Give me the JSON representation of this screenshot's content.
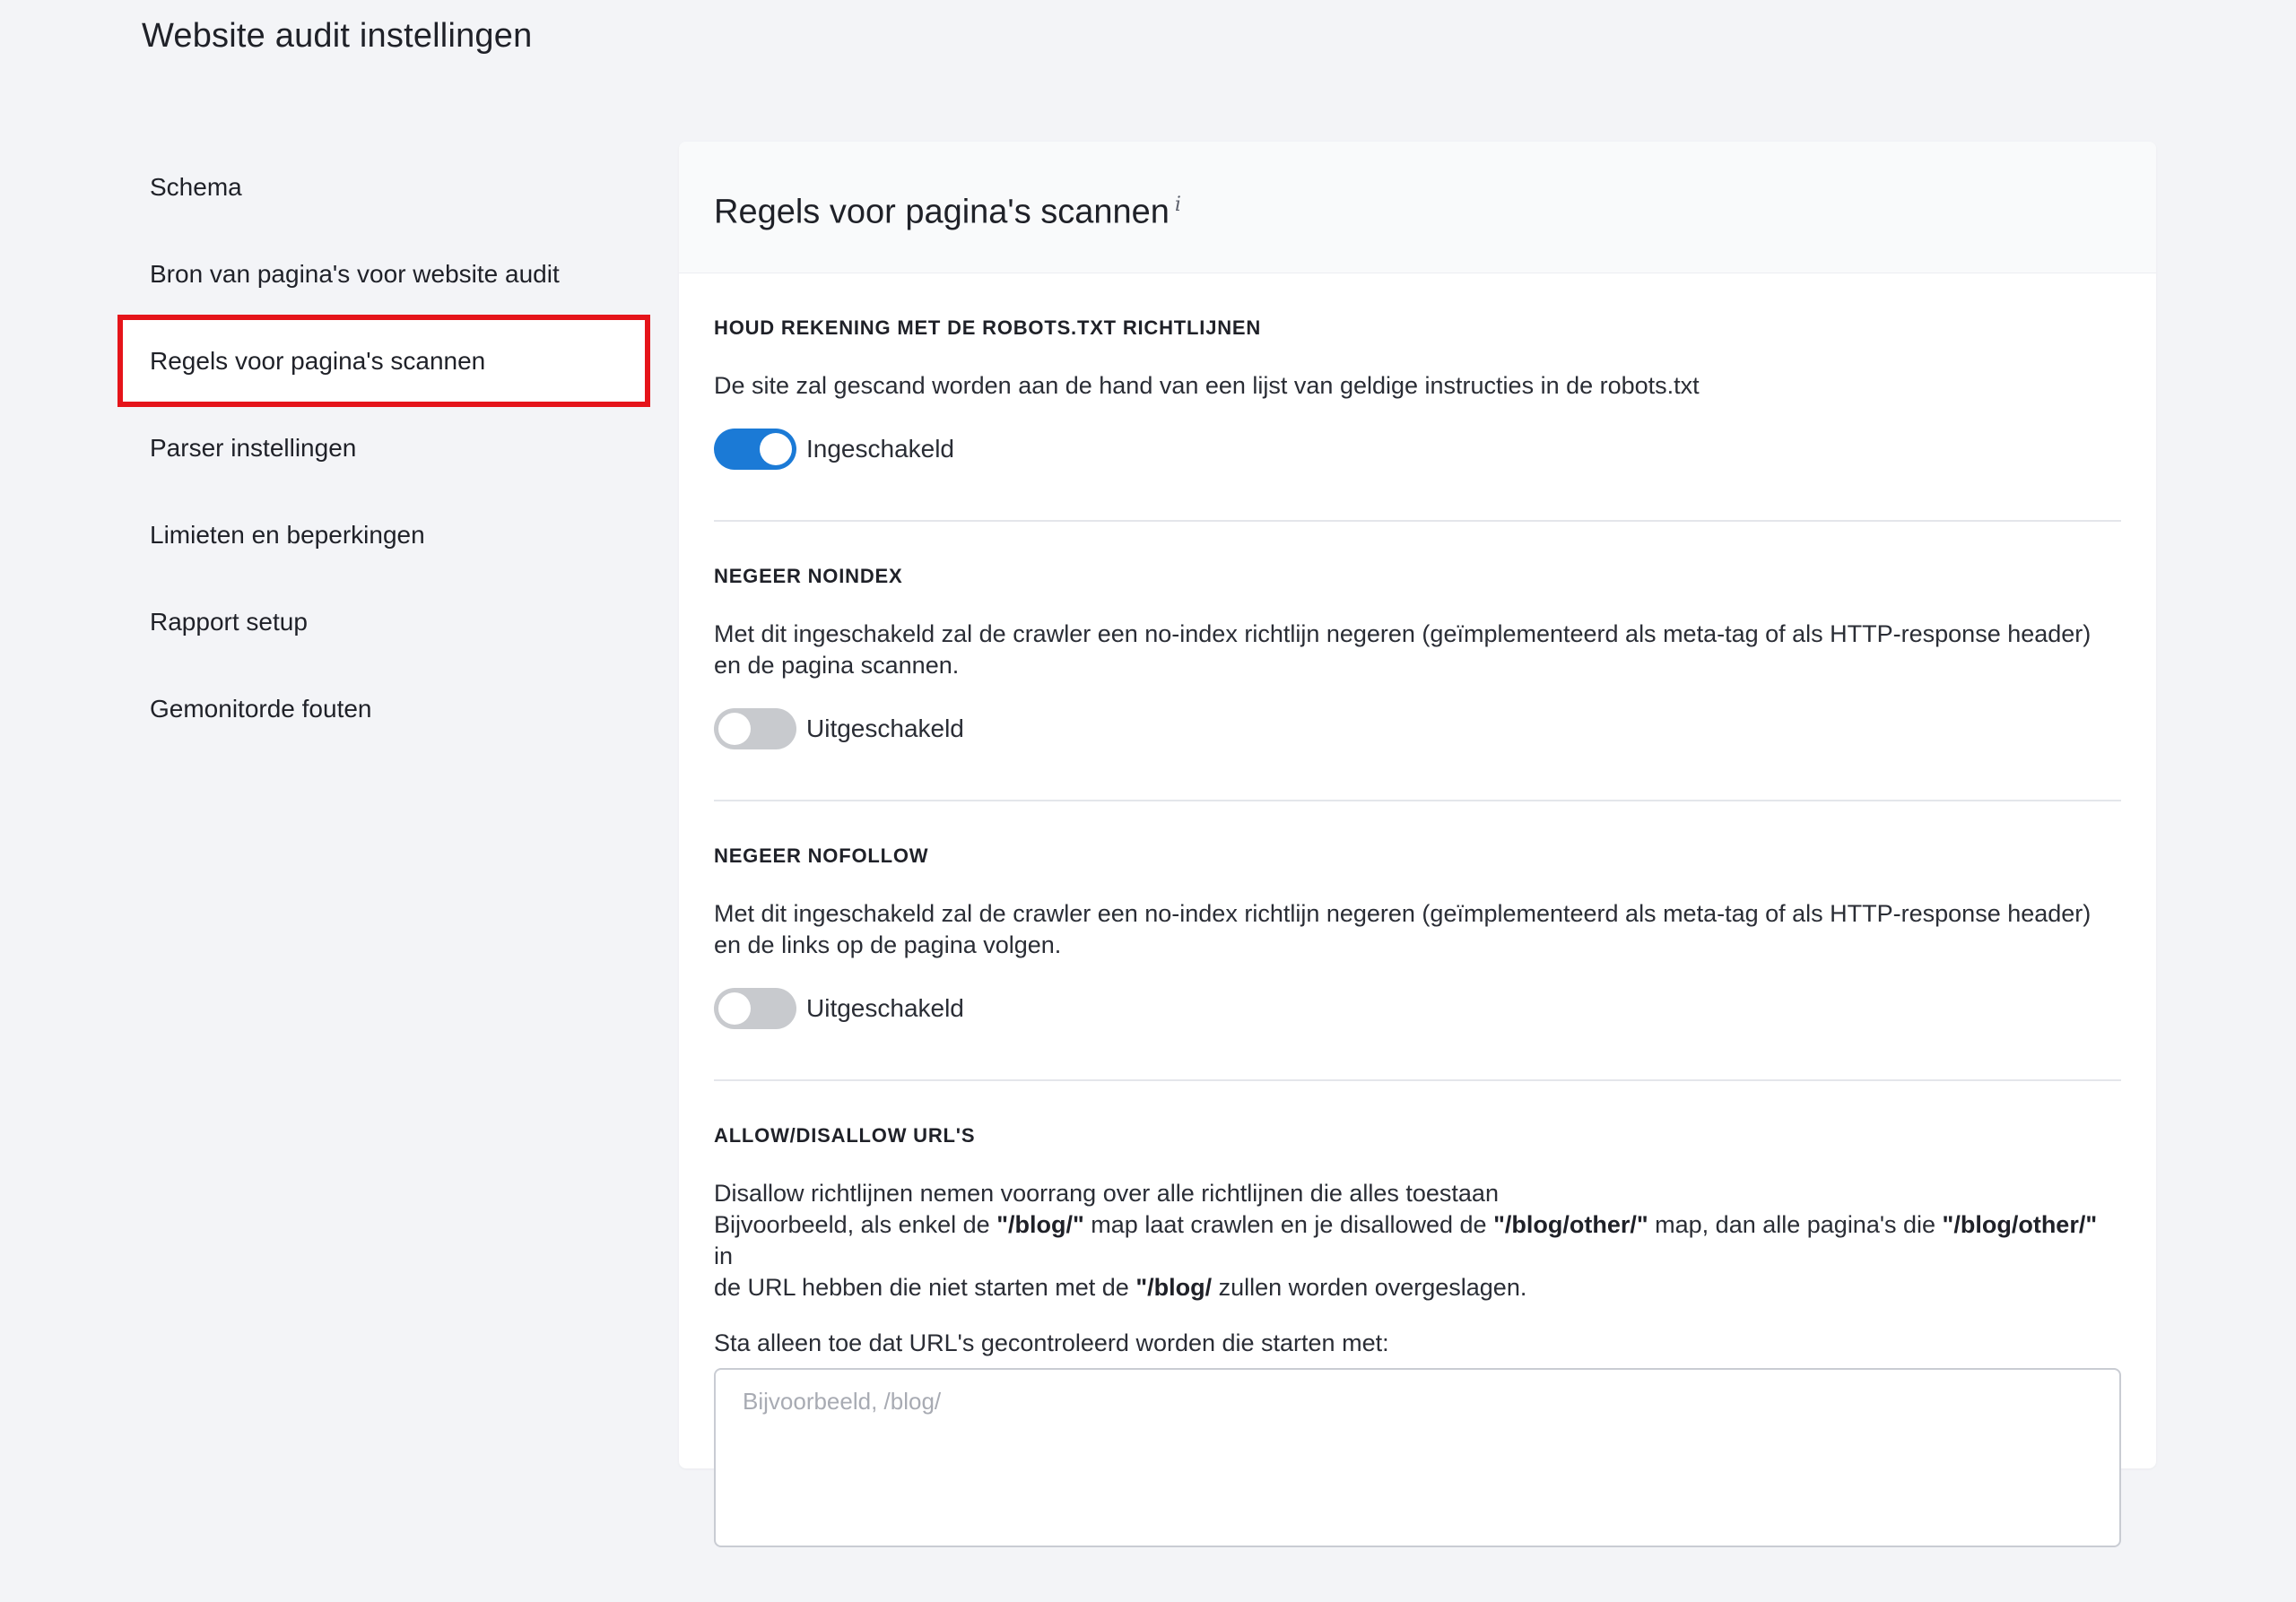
{
  "page": {
    "title": "Website audit instellingen"
  },
  "sidebar": {
    "items": [
      {
        "label": "Schema"
      },
      {
        "label": "Bron van pagina's voor website audit"
      },
      {
        "label": "Regels voor pagina's scannen",
        "active": true
      },
      {
        "label": "Parser instellingen"
      },
      {
        "label": "Limieten en beperkingen"
      },
      {
        "label": "Rapport setup"
      },
      {
        "label": "Gemonitorde fouten"
      }
    ]
  },
  "panel": {
    "title": "Regels voor pagina's scannen",
    "info_icon": "i",
    "sections": [
      {
        "title": "HOUD REKENING MET DE ROBOTS.TXT RICHTLIJNEN",
        "description": "De site zal gescand worden aan de hand van een lijst van geldige instructies in de robots.txt",
        "toggle": {
          "state": "on",
          "label": "Ingeschakeld"
        }
      },
      {
        "title": "NEGEER NOINDEX",
        "description_line1": "Met dit ingeschakeld zal de crawler een no-index richtlijn negeren (geïmplementeerd als meta-tag of als HTTP-response header)",
        "description_line2": "en de pagina scannen.",
        "toggle": {
          "state": "off",
          "label": "Uitgeschakeld"
        }
      },
      {
        "title": "NEGEER NOFOLLOW",
        "description_line1": "Met dit ingeschakeld zal de crawler een no-index richtlijn negeren (geïmplementeerd als meta-tag of als HTTP-response header)",
        "description_line2": "en de links op de pagina volgen.",
        "toggle": {
          "state": "off",
          "label": "Uitgeschakeld"
        }
      },
      {
        "title": "ALLOW/DISALLOW URL'S",
        "line1": "Disallow richtlijnen nemen voorrang over alle richtlijnen die alles toestaan",
        "line2_a": "Bijvoorbeeld, als enkel de ",
        "line2_b": "\"/blog/\"",
        "line2_c": " map laat crawlen en je disallowed de ",
        "line2_d": "\"/blog/other/\"",
        "line2_e": " map, dan alle pagina's die ",
        "line2_f": "\"/blog/other/\"",
        "line2_g": " in",
        "line3_a": "de URL hebben die niet starten met de ",
        "line3_b": "\"/blog/",
        "line3_c": " zullen worden overgeslagen.",
        "field_label": "Sta alleen toe dat URL's gecontroleerd worden die starten met:",
        "field_value": "",
        "field_placeholder": "Bijvoorbeeld, /blog/"
      }
    ]
  },
  "colors": {
    "background": "#f3f4f7",
    "toggle_on": "#1b7ad6",
    "toggle_off": "#c8cace",
    "highlight_box": "#e5141a"
  }
}
